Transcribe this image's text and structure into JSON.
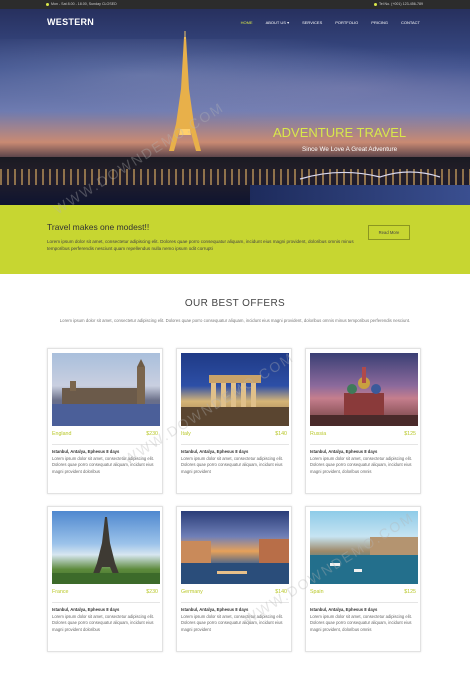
{
  "topbar": {
    "hours": "Mon - Sat 8.00 - 18.00, Sunday CLOSED",
    "phone": "Tel No. (+001) 123-456-789"
  },
  "brand": {
    "logo": "WESTERN"
  },
  "nav": {
    "items": [
      "HOME",
      "ABOUT US ▾",
      "SERVICES",
      "PORTFOLIO",
      "PRICING",
      "CONTACT"
    ],
    "active": "HOME"
  },
  "hero": {
    "title": "ADVENTURE TRAVEL",
    "subtitle": "Since We Love A Great Adventure"
  },
  "band": {
    "title": "Travel makes one modest!!",
    "text": "Lorem ipsum dolor sit amet, consectetur adipiscing elit. Dolores quae porro consequatur aliquam, incidunt eius magni provident, doloribus omnis minus temporibus perferendis nesciunt quam repellendus nulla nemo ipsum odit corrupti",
    "button": "Read More"
  },
  "offers": {
    "title": "OUR BEST OFFERS",
    "subtitle": "Lorem ipsum dolor sit amet, consectetur adipiscing elit. Dolores quae porro consequatur aliquam, incidunt eius magni provident, doloribus omnis minus temporibus perferendis nesciunt.",
    "cards": [
      {
        "name": "England",
        "price": "$230",
        "route": "Istanbul, Antalya, Ephesus 8 days",
        "desc": "Lorem ipsum dolor sit amet, consectetur adipiscing elit. Dolores quae porro consequatur aliquam, incidunt eius magni provident doloribus"
      },
      {
        "name": "Italy",
        "price": "$140",
        "route": "Istanbul, Antalya, Ephesus 8 days",
        "desc": "Lorem ipsum dolor sit amet, consectetur adipiscing elit. Dolores quae porro consequatur aliquam, incidunt eius magni provident"
      },
      {
        "name": "Russia",
        "price": "$125",
        "route": "Istanbul, Antalya, Ephesus 8 days",
        "desc": "Lorem ipsum dolor sit amet, consectetur adipiscing elit. Dolores quae porro consequatur aliquam, incidunt eius magni provident, doloribus omnis"
      },
      {
        "name": "France",
        "price": "$230",
        "route": "Istanbul, Antalya, Ephesus 8 days",
        "desc": "Lorem ipsum dolor sit amet, consectetur adipiscing elit. Dolores quae porro consequatur aliquam, incidunt eius magni provident doloribus"
      },
      {
        "name": "Germany",
        "price": "$140",
        "route": "Istanbul, Antalya, Ephesus 8 days",
        "desc": "Lorem ipsum dolor sit amet, consectetur adipiscing elit. Dolores quae porro consequatur aliquam, incidunt eius magni provident"
      },
      {
        "name": "Spain",
        "price": "$125",
        "route": "Istanbul, Antalya, Ephesus 8 days",
        "desc": "Lorem ipsum dolor sit amet, consectetur adipiscing elit. Dolores quae porro consequatur aliquam, incidunt eius magni provident, doloribus omnis"
      }
    ]
  },
  "watermark": "WWW.DOWNDEMO.COM",
  "colors": {
    "accent": "#d9e84a",
    "band": "#c7d631",
    "topbar": "#2c2c2c"
  }
}
